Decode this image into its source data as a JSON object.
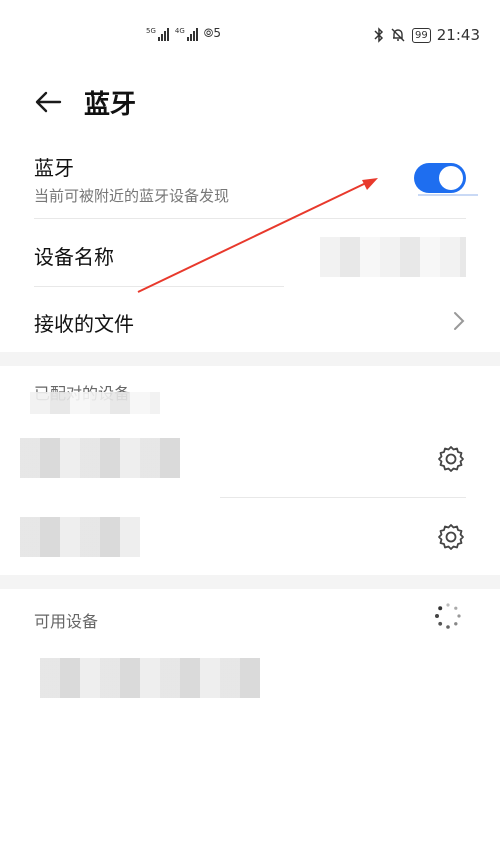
{
  "status_bar": {
    "signal1_label": "5G",
    "signal2_label": "4G",
    "hotspot_label": "⦾5",
    "bluetooth_icon": "bluetooth-icon",
    "mute_icon": "bell-off-icon",
    "battery": "99",
    "time": "21:43"
  },
  "header": {
    "back_icon": "back-arrow-icon",
    "title": "蓝牙"
  },
  "bluetooth_row": {
    "title": "蓝牙",
    "subtitle": "当前可被附近的蓝牙设备发现",
    "toggle_on": true,
    "accent": "#1e6ef0"
  },
  "device_name_row": {
    "title": "设备名称"
  },
  "received_files_row": {
    "title": "接收的文件"
  },
  "paired_section": {
    "label": "已配对的设备"
  },
  "available_section": {
    "label": "可用设备"
  },
  "annotation": {
    "color": "#e8392c"
  }
}
